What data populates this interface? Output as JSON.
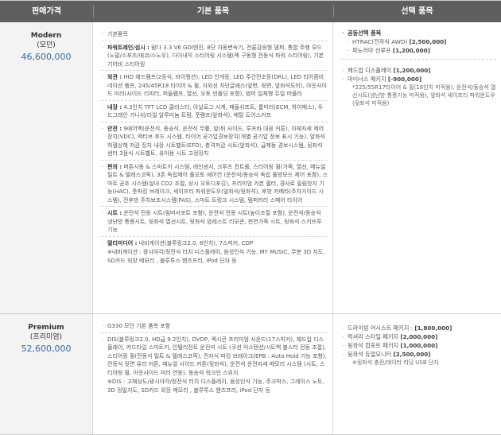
{
  "header": {
    "grade": "판매가격",
    "basic": "기본 품목",
    "option": "선택 품목"
  },
  "modern": {
    "name": "Modern",
    "sub": "(모던)",
    "price": "46,600,000",
    "basic": {
      "default": "기본품목",
      "powertrain": {
        "label": "파워트레인/섬시 :",
        "text": " 람다 3.3 V6 GDI엔진, 8단 자동변속기, 전륜감응형 댐퍼, 통합 주행 모드(노말/스포츠/에코/스노우), 다이내믹 스티어링 시스템(랙 구동형 전동식 파워 스티어링), 기본 기어비 스티어링"
      },
      "exterior": {
        "label": "외관 :",
        "text": " HID 헤드램프(2등식, 바이펑션), LED 안개등, LED 주간전조등(DRL), LED 리어콤비네이션 램프, 245/45R18 타이어 & 휠, 자외선 차단글래스(앞면, 뒷면, 앞좌석도어), 아웃사이드 미러(사이드 리피터, 퍼들램프, 열선, 오토 언폴딩 포함), 범퍼 일체형 듀얼 머플러"
      },
      "interior": {
        "label": "내장 :",
        "text": " 4.3인치 TFT LCD 클러스터, 아날로그 시계, 패들쉬프트, 룸미러(ECM, 하이패스), 우드그레인 가니쉬/리얼 알루미늄 트림, 풋램프(앞좌석), 메탈 도어스커프"
      },
      "safety": {
        "label": "안전 :",
        "text": " 9에어백(운전석, 동승석, 운전석 무릎, 앞/뒤 사이드, 루프바 대응 커튼), 차체자세 제어장치(VDC), 액티브 후드 시스템, 타이어 공기압경보장치(개별 공기압 정보 표시 기능), 앞좌석 허혈상해 저감 장치 내장 시트벨트(EFD), 충격저감 시트(앞좌석), 급제동 경보시스템, 뒷좌석 센터 3점식 시트벨트, 유아용 시트 고정장치"
      },
      "convenience": {
        "label": "편의 :",
        "text": " 버튼시동 & 스마트키 시스템, 레인센서, 크루즈 컨트롤, 스티어링 휠(가죽, 열선, 메뉴얼 틸트 & 텔레스코픽), 3존 독립제어 풀오토 에어컨 (운전석/동승석 독립 풀방모드 제어 포함), 스마트 공조 시스템(실내 CO2 조절, 상시 오토디포깅), 프리미엄 카본 필터, 경사로 밀림방지 기능(HAC), 풋파킹 브레이크, 세이프티 파워윈도우(앞좌석/뒷좌석), 후방 카메라(주차가이드 시스템), 전후방 주차보조시스템(PAS), 스마트 트렁크 시스템, 템퍼러리 스페어 타이어"
      },
      "seat": {
        "label": "시트 :",
        "text": " 운전석 전동 시트(럼버서포트 포함), 운전석 전동 시트(높이조절 포함), 운전석/동승석 냉난방 통풍시트, 뒷좌석 열선시트, 뒷좌석 암레스트 리모콘, 천연가죽 시트, 뒷좌석 스키쓰루 기능"
      },
      "multimedia": {
        "label": "멀티미디어 :",
        "text": " 내비게이션(블루링크2.0, 8인치), 7스피커, CDP"
      },
      "multimedia_note": "※내비게이션 : 광시야각/정전식 터치 디스플레이, 음성인식 기능, MY MUSIC, 무분 3D 지도, SD카드 외장 메모리 , 블루투스 핸즈프리, iPod 단자 등"
    },
    "option": {
      "group_title": "공동선택 품목",
      "group_items": [
        {
          "text": "HTRAC(전자식 AWD) ",
          "price": "[2,500,000]"
        },
        {
          "text": "파노라마 선루프 ",
          "price": "[1,200,000]"
        }
      ],
      "items": [
        {
          "text": "헤드업 디스플레이 ",
          "price": "[1,200,000]"
        },
        {
          "text": "마이너스 패키지 ",
          "price": "[-900,000]"
        }
      ],
      "minus_note": "*225/55R17타이어 & 휠(18인치 미적용), 운전석/동승석 열선시트(냉난방 통풍기능 미적용), 앞좌석 세이프티 파워윈도우(뒷좌석 미적용)"
    }
  },
  "premium": {
    "name": "Premium",
    "sub": "(프리미엄)",
    "price": "52,600,000",
    "basic": {
      "base": "G330 모던 기본 품목 포함",
      "text": "DIS(블루링크2.0, HD급 9.2인치), DVDP, 렉시콘 프리미엄 사운드(17스피커), 헤드업 디스플레이, 카드타입 스마트키, 인텔리전트 운전석 시트 (쿠션 익스텐션/시트백 볼스터 전동 조절), 스티어링 휠(전동식 틸트 & 텔레스코픽), 전자식 파킹 브레이크(EPB : Auto Hold 기능 포함), 전동식 뒷면 유리 커튼, 매뉴얼 사이드 커튼(뒷좌석), 운전석 운전자세 메모리 시스템 (시트, 스티어링 휠, 아웃사이드 미러 연동), 동승석 워크인 스위치",
      "note": "※DIS : 고해상도/광시야각/정전식 터치 디스플레이, 음성인식 기능, 주크박스, 그레이스 노트, 3D 정밀지도, SD카드 외장 메모리 , 블루투스 핸즈프리, iPod 단자 등"
    },
    "option": {
      "items": [
        {
          "text": "드라이빙 어시스트 패키지 : ",
          "price": "[1,800,000]"
        },
        {
          "text": "럭셔리 스타일 패키지 ",
          "price": "[2,000,000]"
        },
        {
          "text": "뒷좌석 컴포트 패키지 ",
          "price": "[1,000,000]"
        },
        {
          "text": "뒷좌석 듀얼모니터 ",
          "price": "[2,500,000]"
        }
      ],
      "dual_note": "※뒷좌석 충전/데이터 리딩 USB 단자"
    }
  }
}
